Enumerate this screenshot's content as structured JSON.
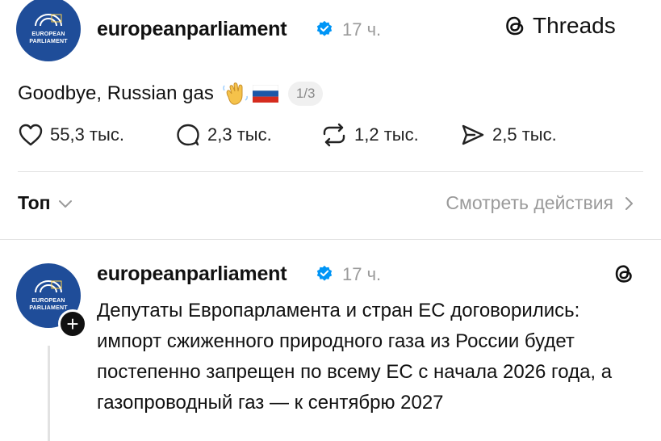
{
  "post": {
    "username": "europeanparliament",
    "time": "17 ч.",
    "avatar_text": "EUROPEAN PARLIAMENT",
    "brand": "Threads",
    "text": "Goodbye, Russian gas",
    "emoji": "👋🇷🇺",
    "page_indicator": "1/3"
  },
  "stats": {
    "likes": "55,3 тыс.",
    "replies": "2,3 тыс.",
    "reposts": "1,2 тыс.",
    "shares": "2,5 тыс."
  },
  "sort": {
    "label": "Топ",
    "activity_link": "Смотреть действия"
  },
  "reply": {
    "username": "europeanparliament",
    "time": "17 ч.",
    "avatar_text": "EUROPEAN PARLIAMENT",
    "text": "Депутаты Европарламента и стран ЕС договорились: импорт сжиженного природного газа из России будет постепенно запрещен по всему ЕС с начала 2026 года, а газопроводный газ — к сентябрю 2027"
  },
  "colors": {
    "avatar_blue": "#1f4d99",
    "verified_blue": "#0095f6",
    "muted_text": "#9a9a9a",
    "divider": "#e3e3e3"
  },
  "icons": {
    "like": "heart-icon",
    "reply": "speech-bubble-icon",
    "repost": "repost-icon",
    "share": "send-icon",
    "verified": "verified-badge-icon",
    "brand": "threads-logo-icon",
    "chevron_down": "chevron-down-icon",
    "chevron_right": "chevron-right-icon",
    "plus": "plus-icon"
  }
}
